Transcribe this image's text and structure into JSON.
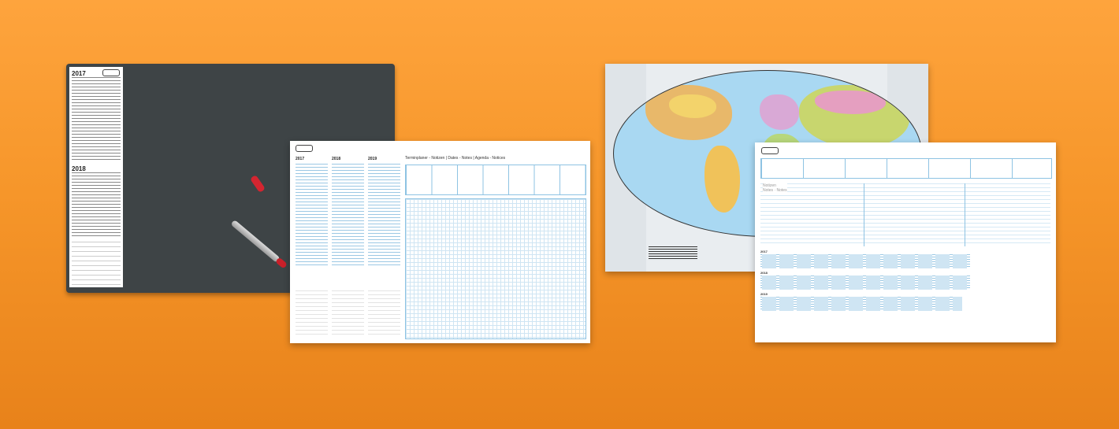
{
  "left_pad": {
    "years": [
      "2017",
      "2018"
    ]
  },
  "center_pad": {
    "years": [
      "2017",
      "2018",
      "2019"
    ],
    "title": "Terminplaner - Notizen | Dates - Notes | Agenda - Notices"
  },
  "right_pad": {
    "notes_label": "Notizen\nNotes · Notes",
    "years": [
      "2017",
      "2018",
      "2019"
    ]
  },
  "colors": {
    "background": "#f6962a",
    "pad": "#3e4446",
    "accent_blue": "#8ec3e3",
    "marker_red": "#c8202a"
  }
}
